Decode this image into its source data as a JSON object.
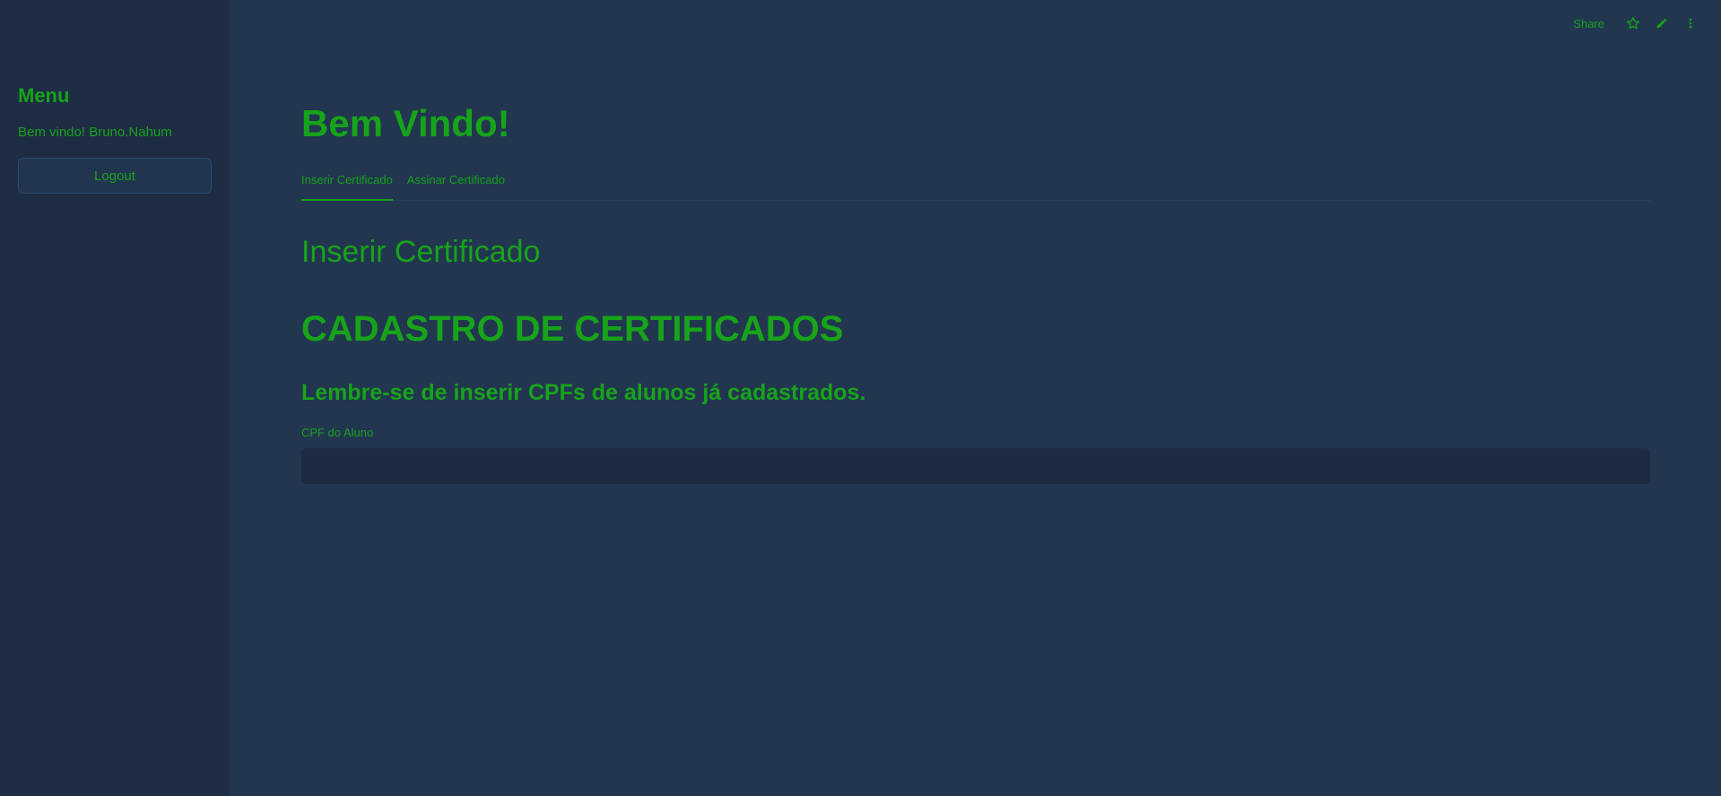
{
  "sidebar": {
    "title": "Menu",
    "welcome": "Bem vindo! Bruno.Nahum",
    "logout_label": "Logout"
  },
  "topbar": {
    "share_label": "Share",
    "icons": [
      "star-icon",
      "pencil-icon",
      "more-vert-icon"
    ]
  },
  "main": {
    "page_title": "Bem Vindo!",
    "tabs": [
      {
        "label": "Inserir Certificado",
        "active": true
      },
      {
        "label": "Assinar Certificado",
        "active": false
      }
    ],
    "section_title": "Inserir Certificado",
    "big_title": "CADASTRO DE CERTIFICADOS",
    "subtitle": "Lembre-se de inserir CPFs de alunos já cadastrados.",
    "cpf_field": {
      "label": "CPF do Aluno",
      "value": "",
      "placeholder": ""
    }
  },
  "colors": {
    "accent": "#17a31a",
    "background": "#223650",
    "sidebar_background": "#1e2c44",
    "input_background": "#1d2b42"
  }
}
